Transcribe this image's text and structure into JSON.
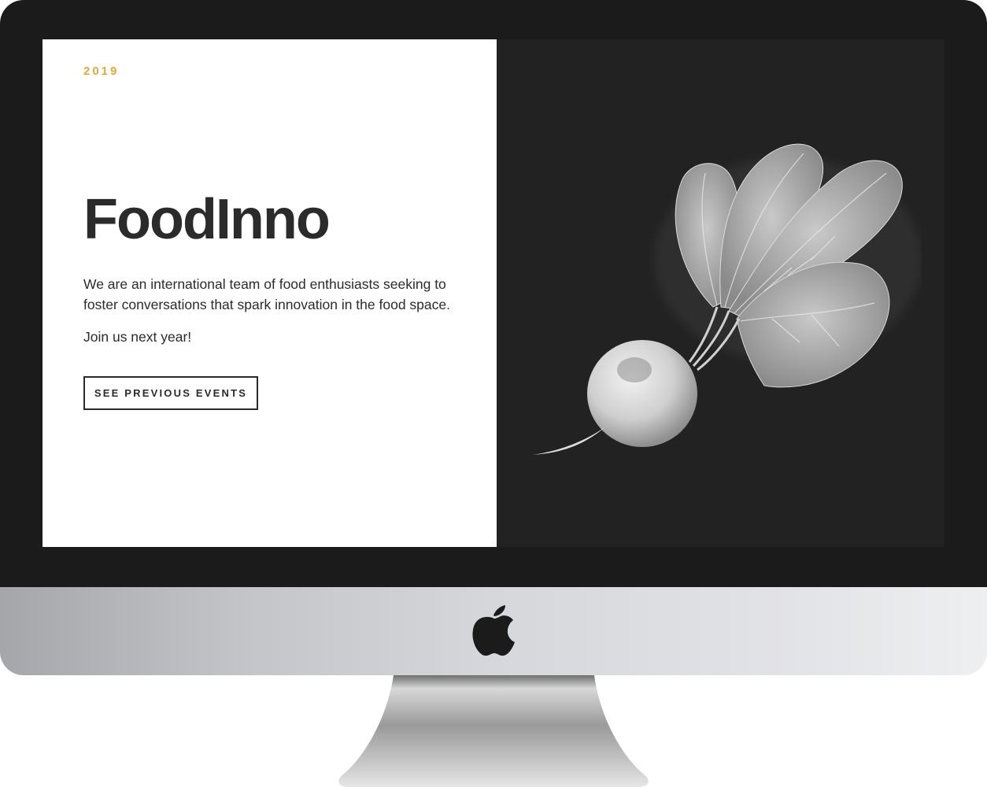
{
  "hero": {
    "year": "2019",
    "title": "FoodInno",
    "description": "We are an international team of food enthusiasts seeking to foster conversations that spark innovation in the food space.",
    "cta_text": "Join us next year!",
    "button_label": "SEE PREVIOUS EVENTS"
  },
  "media": {
    "image_icon": "radish-illustration"
  },
  "device": {
    "logo_icon": "apple-icon"
  },
  "colors": {
    "accent": "#e5a93a",
    "text": "#2b2b2b",
    "dark_panel": "#222222",
    "bezel": "#1b1b1b"
  }
}
